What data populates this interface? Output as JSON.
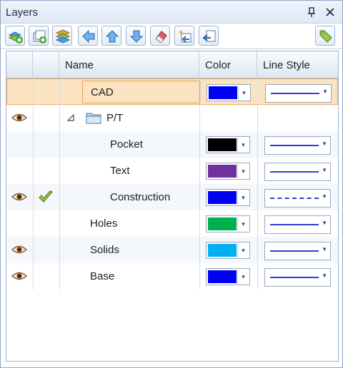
{
  "window": {
    "title": "Layers"
  },
  "toolbar": {
    "tools": [
      "add-layer-icon",
      "add-sublayer-icon",
      "layer-stack-icon",
      "arrow-left-icon",
      "arrow-up-icon",
      "arrow-down-icon",
      "eraser-icon",
      "new-layer-sparkle-icon",
      "import-layer-icon",
      "tag-icon"
    ]
  },
  "columns": {
    "name": "Name",
    "color": "Color",
    "line_style": "Line Style"
  },
  "layers": [
    {
      "name": "CAD",
      "color": "#0000f5",
      "line": "solid",
      "visible": false,
      "active": false,
      "selected": true
    },
    {
      "name": "P/T",
      "folder": true,
      "expanded": true,
      "visible": true
    },
    {
      "name": "Pocket",
      "color": "#000000",
      "line": "solid",
      "visible": false
    },
    {
      "name": "Text",
      "color": "#7030a0",
      "line": "solid",
      "visible": false
    },
    {
      "name": "Construction",
      "color": "#0000f5",
      "line": "dashed",
      "visible": true,
      "active": true
    },
    {
      "name": "Holes",
      "color": "#00b050",
      "line": "solid",
      "visible": false
    },
    {
      "name": "Solids",
      "color": "#00b0f0",
      "line": "solid",
      "visible": true
    },
    {
      "name": "Base",
      "color": "#0000f5",
      "line": "solid",
      "visible": true
    }
  ]
}
